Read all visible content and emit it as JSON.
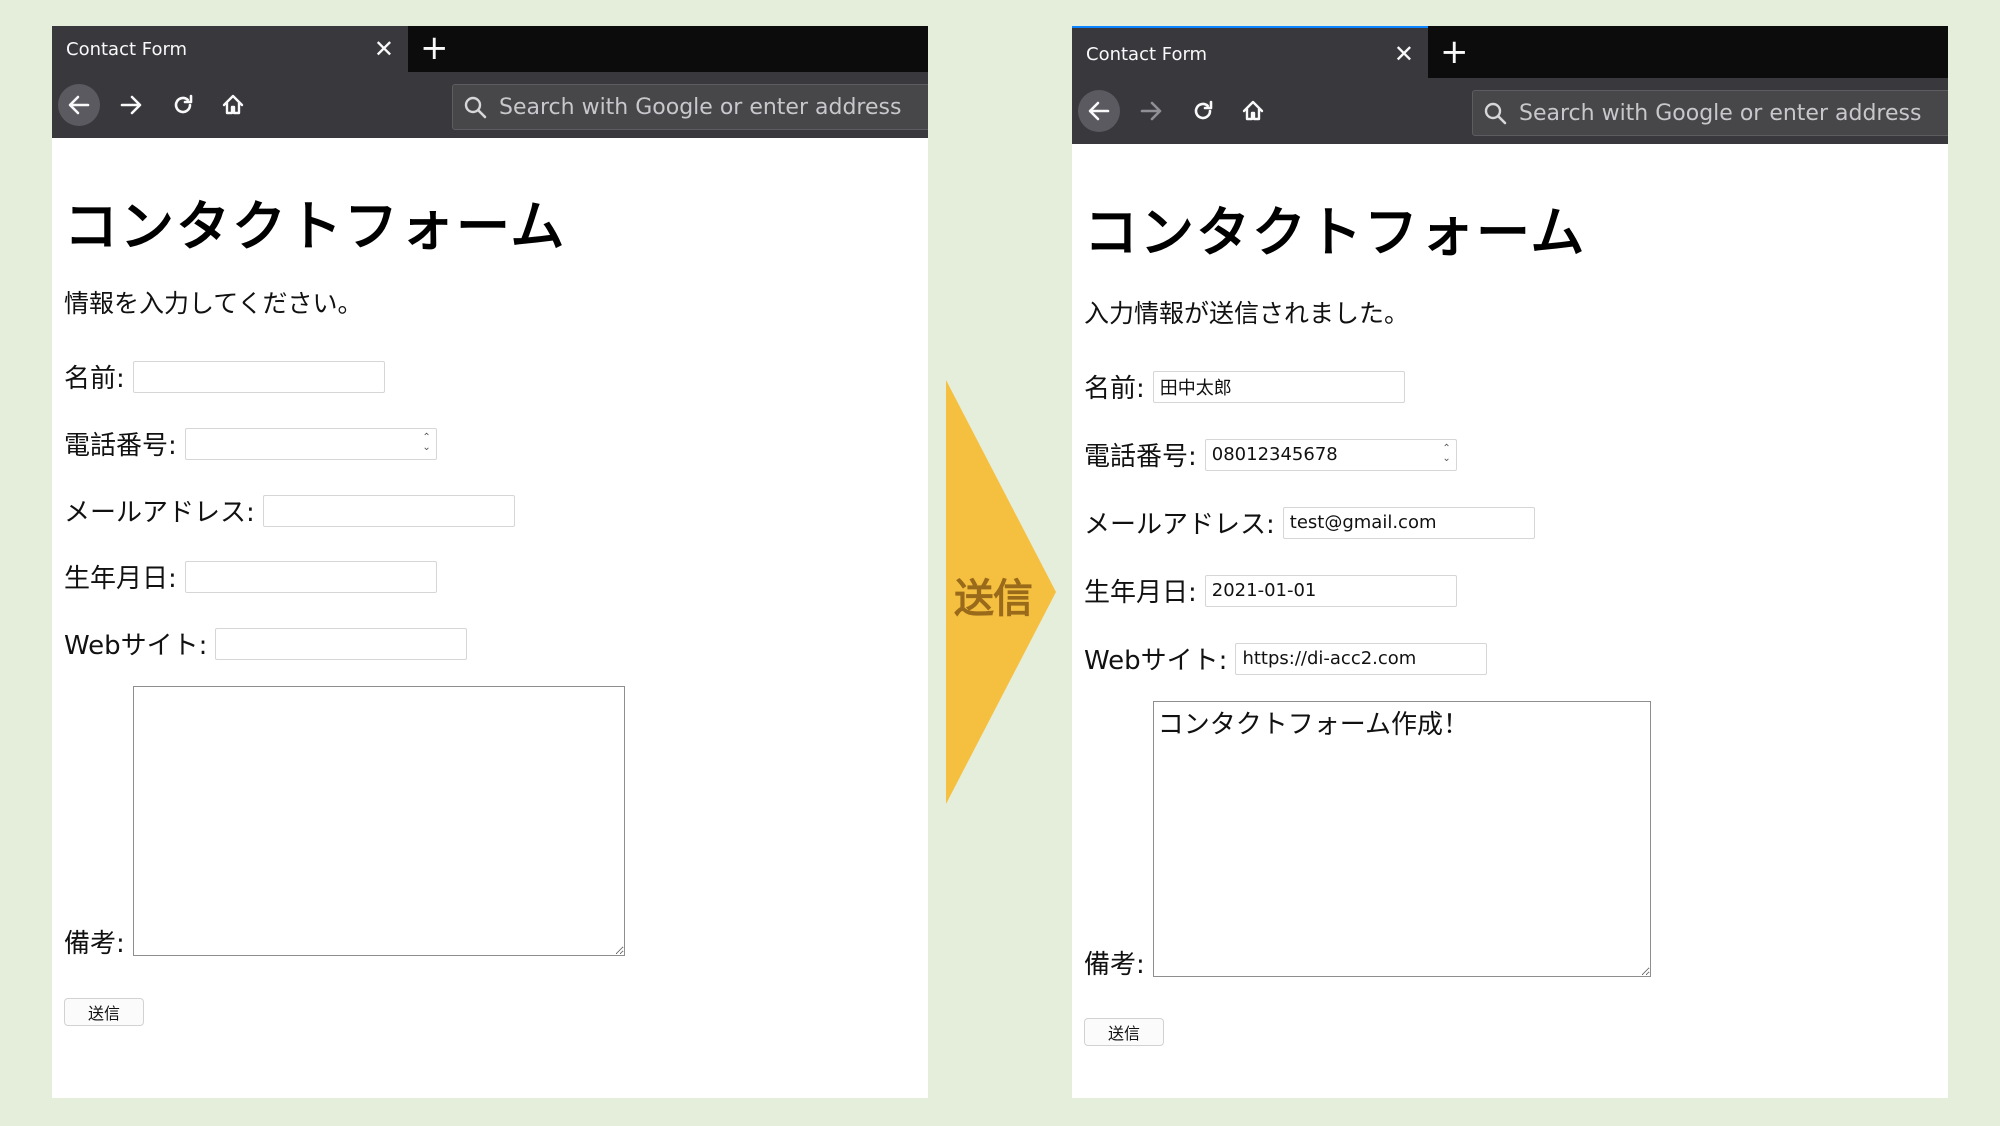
{
  "left": {
    "tab_title": "Contact Form",
    "url_placeholder": "Search with Google or enter address",
    "heading": "コンタクトフォーム",
    "intro": "情報を入力してください。",
    "fields": {
      "name": {
        "label": "名前:",
        "value": ""
      },
      "phone": {
        "label": "電話番号:",
        "value": ""
      },
      "email": {
        "label": "メールアドレス:",
        "value": ""
      },
      "birthday": {
        "label": "生年月日:",
        "value": ""
      },
      "website": {
        "label": "Webサイト:",
        "value": ""
      },
      "notes": {
        "label": "備考:",
        "value": ""
      }
    },
    "submit": "送信"
  },
  "arrow": {
    "label": "送信",
    "color": "#f5c040",
    "text_color": "#9a6a1b"
  },
  "right": {
    "tab_title": "Contact Form",
    "url_placeholder": "Search with Google or enter address",
    "heading": "コンタクトフォーム",
    "intro": "入力情報が送信されました。",
    "fields": {
      "name": {
        "label": "名前:",
        "value": "田中太郎"
      },
      "phone": {
        "label": "電話番号:",
        "value": "08012345678"
      },
      "email": {
        "label": "メールアドレス:",
        "value": "test@gmail.com"
      },
      "birthday": {
        "label": "生年月日:",
        "value": "2021-01-01"
      },
      "website": {
        "label": "Webサイト:",
        "value": "https://di-acc2.com"
      },
      "notes": {
        "label": "備考:",
        "value": "コンタクトフォーム作成！"
      }
    },
    "submit": "送信"
  },
  "icons": [
    "back-arrow-icon",
    "forward-arrow-icon",
    "reload-icon",
    "home-icon",
    "search-icon",
    "close-icon",
    "plus-icon"
  ]
}
